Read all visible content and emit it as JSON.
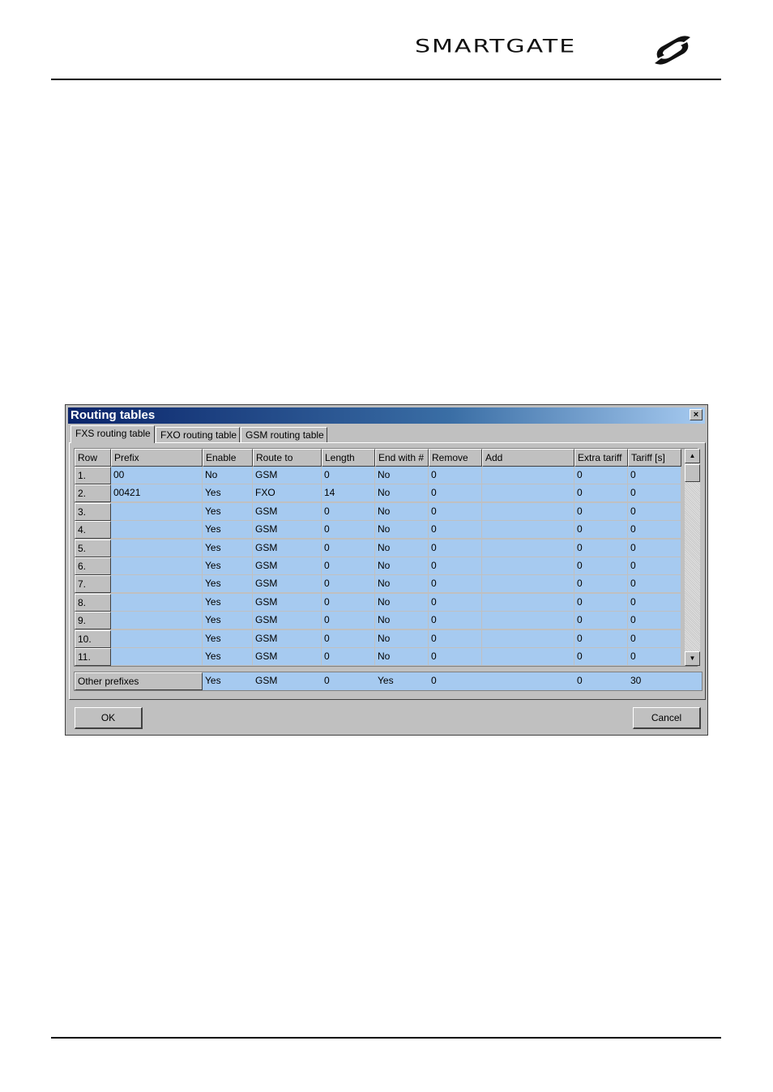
{
  "brand": {
    "name": "SMARTGATE",
    "logo_icon": "smartgate-s-logo-icon"
  },
  "dialog": {
    "title": "Routing tables",
    "close_label": "×",
    "tabs": [
      {
        "label": "FXS routing table",
        "active": true
      },
      {
        "label": "FXO routing table",
        "active": false
      },
      {
        "label": "GSM routing table",
        "active": false
      }
    ],
    "columns": [
      "Row",
      "Prefix",
      "Enable",
      "Route to",
      "Length",
      "End with #",
      "Remove",
      "Add",
      "Extra tariff",
      "Tariff [s]"
    ],
    "rows": [
      [
        "1.",
        "00",
        "No",
        "GSM",
        "0",
        "No",
        "0",
        "",
        "0",
        "0"
      ],
      [
        "2.",
        "00421",
        "Yes",
        "FXO",
        "14",
        "No",
        "0",
        "",
        "0",
        "0"
      ],
      [
        "3.",
        "",
        "Yes",
        "GSM",
        "0",
        "No",
        "0",
        "",
        "0",
        "0"
      ],
      [
        "4.",
        "",
        "Yes",
        "GSM",
        "0",
        "No",
        "0",
        "",
        "0",
        "0"
      ],
      [
        "5.",
        "",
        "Yes",
        "GSM",
        "0",
        "No",
        "0",
        "",
        "0",
        "0"
      ],
      [
        "6.",
        "",
        "Yes",
        "GSM",
        "0",
        "No",
        "0",
        "",
        "0",
        "0"
      ],
      [
        "7.",
        "",
        "Yes",
        "GSM",
        "0",
        "No",
        "0",
        "",
        "0",
        "0"
      ],
      [
        "8.",
        "",
        "Yes",
        "GSM",
        "0",
        "No",
        "0",
        "",
        "0",
        "0"
      ],
      [
        "9.",
        "",
        "Yes",
        "GSM",
        "0",
        "No",
        "0",
        "",
        "0",
        "0"
      ],
      [
        "10.",
        "",
        "Yes",
        "GSM",
        "0",
        "No",
        "0",
        "",
        "0",
        "0"
      ],
      [
        "11.",
        "",
        "Yes",
        "GSM",
        "0",
        "No",
        "0",
        "",
        "0",
        "0"
      ]
    ],
    "other_prefixes": {
      "label": "Other prefixes",
      "values": [
        "Yes",
        "GSM",
        "0",
        "Yes",
        "0",
        "",
        "0",
        "30"
      ]
    },
    "ok_label": "OK",
    "cancel_label": "Cancel",
    "colors": {
      "title_start": "#0a246a",
      "title_end": "#a6caf0",
      "cell_bg": "#a6caf0",
      "face": "#c0c0c0"
    }
  }
}
